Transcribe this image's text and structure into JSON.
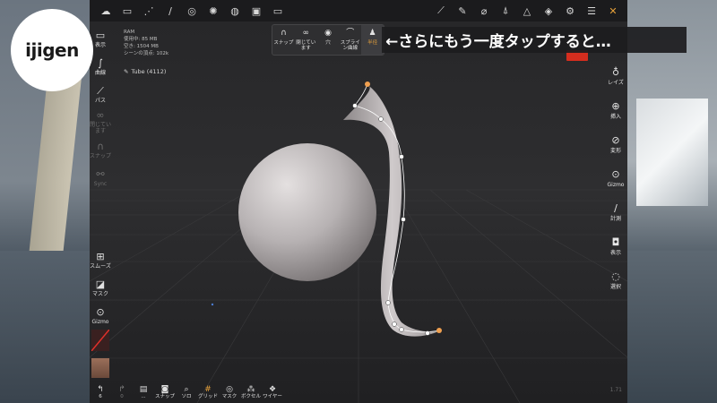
{
  "logo": {
    "text": "ijigen"
  },
  "topbar": {
    "left_icons": [
      "menu-icon",
      "folder-icon",
      "scene-icon",
      "brush-icon",
      "globe-icon",
      "sun-icon",
      "material-icon",
      "image-icon",
      "video-icon"
    ],
    "right_icons": [
      "stroke-icon",
      "pen-icon",
      "dropper-icon",
      "symmetry-icon",
      "triangle-icon",
      "layers-icon",
      "settings-icon",
      "sliders-icon",
      "tools-icon"
    ]
  },
  "left_toolbar": {
    "items": [
      {
        "label": "表示",
        "icon": "camera-icon",
        "active": true
      },
      {
        "label": "曲線",
        "icon": "curve-icon",
        "active": true
      },
      {
        "label": "パス",
        "icon": "path-icon",
        "active": true
      },
      {
        "label": "閉じています",
        "icon": "infinity-icon",
        "active": false
      },
      {
        "label": "スナップ",
        "icon": "magnet-icon",
        "active": false
      },
      {
        "label": "Sync",
        "icon": "link-icon",
        "active": false
      }
    ],
    "lower_items": [
      {
        "label": "スムーズ",
        "icon": "plus-square-icon"
      },
      {
        "label": "マスク",
        "icon": "mask-icon"
      },
      {
        "label": "Gizmo",
        "icon": "gizmo-icon"
      }
    ]
  },
  "right_toolbar": {
    "items": [
      {
        "label": "レイズ",
        "icon": "jar-icon"
      },
      {
        "label": "挿入",
        "icon": "insert-icon"
      },
      {
        "label": "変形",
        "icon": "transform-icon"
      },
      {
        "label": "Gizmo",
        "icon": "gizmo-icon"
      },
      {
        "label": "計測",
        "icon": "ruler-icon"
      },
      {
        "label": "表示",
        "icon": "camera-icon"
      },
      {
        "label": "選択",
        "icon": "select-icon"
      }
    ]
  },
  "info": {
    "line1": "RAM",
    "line2": "使用中: 85 MB",
    "line3": "空き: 1504 MB",
    "line4": "シーンの頂点: 102k"
  },
  "object": {
    "name": "Tube (4112)"
  },
  "popup": {
    "items": [
      {
        "label": "スナップ",
        "icon": "magnet-icon",
        "active": false
      },
      {
        "label": "閉じています",
        "icon": "infinity-icon",
        "active": false
      },
      {
        "label": "穴",
        "icon": "hole-icon",
        "active": false
      },
      {
        "label": "スプライン曲線",
        "icon": "spline-icon",
        "active": false
      },
      {
        "label": "半径",
        "icon": "radius-icon",
        "active": true
      }
    ]
  },
  "callout": {
    "text": "←さらにもう一度タップすると…"
  },
  "bottom_toolbar": {
    "items": [
      {
        "label": "6",
        "icon": "undo-icon",
        "dim": false,
        "on": false
      },
      {
        "label": "0",
        "icon": "redo-icon",
        "dim": true,
        "on": false
      },
      {
        "label": "...",
        "icon": "book-icon",
        "dim": false,
        "on": false
      },
      {
        "label": "スナップ",
        "icon": "camera-snap-icon",
        "dim": false,
        "on": false
      },
      {
        "label": "ソロ",
        "icon": "search-icon",
        "dim": false,
        "on": false
      },
      {
        "label": "グリッド",
        "icon": "grid-icon",
        "dim": false,
        "on": true
      },
      {
        "label": "マスク",
        "icon": "eye-icon",
        "dim": false,
        "on": false
      },
      {
        "label": "ボクセル",
        "icon": "voxel-icon",
        "dim": false,
        "on": false
      },
      {
        "label": "ワイヤー",
        "icon": "wire-icon",
        "dim": false,
        "on": false
      }
    ],
    "version": "1.71"
  }
}
